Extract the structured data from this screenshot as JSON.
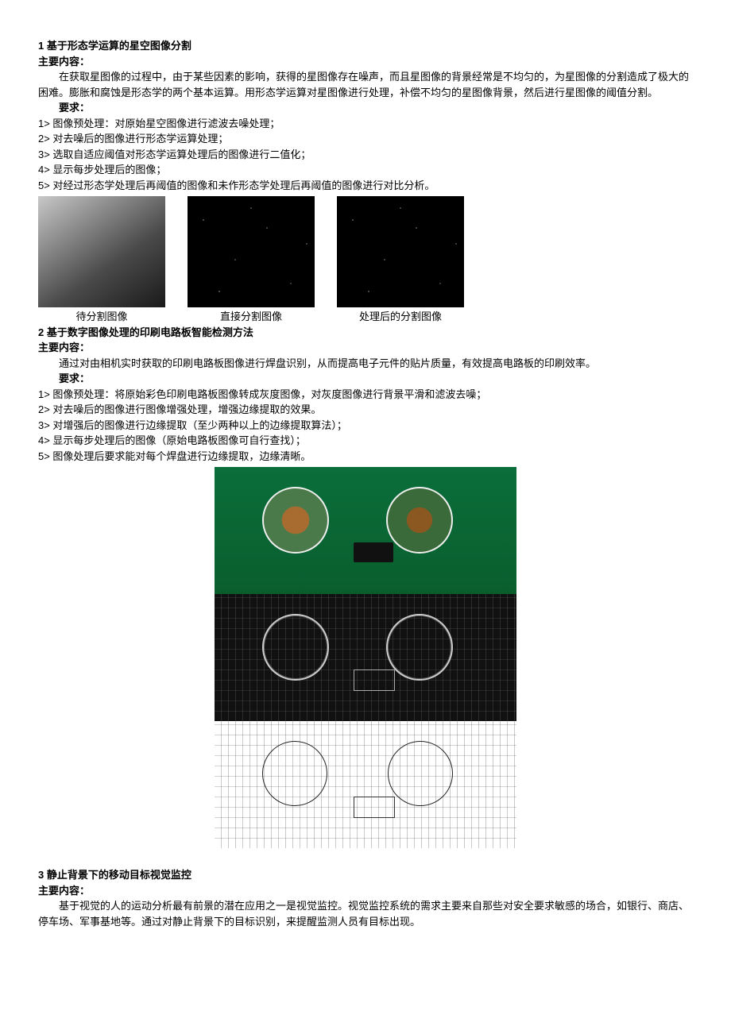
{
  "section1": {
    "title": "1 基于形态学运算的星空图像分割",
    "content_label": "主要内容：",
    "content": "在获取星图像的过程中，由于某些因素的影响，获得的星图像存在噪声，而且星图像的背景经常是不均匀的，为星图像的分割造成了极大的困难。膨胀和腐蚀是形态学的两个基本运算。用形态学运算对星图像进行处理，补偿不均匀的星图像背景，然后进行星图像的阈值分割。",
    "req_label": "要求：",
    "reqs": [
      "1> 图像预处理：对原始星空图像进行滤波去噪处理；",
      "2> 对去噪后的图像进行形态学运算处理；",
      "3> 选取自适应阈值对形态学运算处理后的图像进行二值化；",
      "4> 显示每步处理后的图像；",
      "5> 对经过形态学处理后再阈值的图像和未作形态学处理后再阈值的图像进行对比分析。"
    ],
    "captions": [
      "待分割图像",
      "直接分割图像",
      "处理后的分割图像"
    ]
  },
  "section2": {
    "title": "2 基于数字图像处理的印刷电路板智能检测方法",
    "content_label": "主要内容：",
    "content": "通过对由相机实时获取的印刷电路板图像进行焊盘识别，从而提高电子元件的贴片质量，有效提高电路板的印刷效率。",
    "req_label": "要求：",
    "reqs": [
      "1> 图像预处理：将原始彩色印刷电路板图像转成灰度图像，对灰度图像进行背景平滑和滤波去噪；",
      "2> 对去噪后的图像进行图像增强处理，增强边缘提取的效果。",
      "3> 对增强后的图像进行边缘提取（至少两种以上的边缘提取算法）；",
      "4> 显示每步处理后的图像（原始电路板图像可自行查找）；",
      "5> 图像处理后要求能对每个焊盘进行边缘提取，边缘清晰。"
    ]
  },
  "section3": {
    "title": "3 静止背景下的移动目标视觉监控",
    "content_label": "主要内容：",
    "content": "基于视觉的人的运动分析最有前景的潜在应用之一是视觉监控。视觉监控系统的需求主要来自那些对安全要求敏感的场合，如银行、商店、停车场、军事基地等。通过对静止背景下的目标识别，来提醒监测人员有目标出现。"
  }
}
